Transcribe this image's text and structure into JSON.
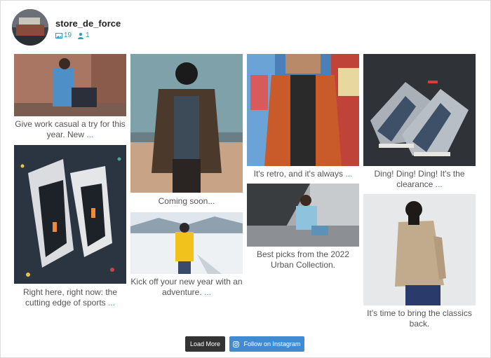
{
  "profile": {
    "username": "store_de_force",
    "posts_count": "19",
    "followers_count": "1",
    "avatar_icon": "store-avatar"
  },
  "posts": [
    {
      "caption": "Give work casual a try for this year. New",
      "more": "..."
    },
    {
      "caption": "Coming soon...",
      "more": ""
    },
    {
      "caption": "It's retro, and it's always",
      "more": "..."
    },
    {
      "caption": "Ding! Ding! Ding! It's the clearance",
      "more": "..."
    },
    {
      "caption": "Right here, right now: the cutting edge of sports",
      "more": "..."
    },
    {
      "caption": "Kick off your new year with an adventure.",
      "more": "..."
    },
    {
      "caption": "Best picks from the 2022 Urban Collection.",
      "more": ""
    },
    {
      "caption": "It's time to bring the classics back.",
      "more": ""
    }
  ],
  "buttons": {
    "load_more": "Load More",
    "follow": "Follow on Instagram",
    "follow_icon": "instagram-icon"
  },
  "colors": {
    "accent": "#2aa0b8",
    "follow_button": "#408bd1",
    "load_button": "#333333"
  }
}
